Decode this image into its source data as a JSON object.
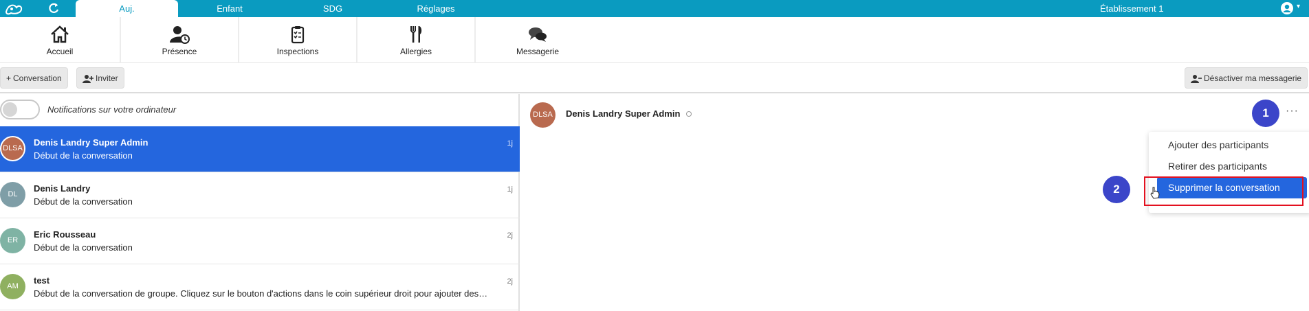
{
  "topbar": {
    "tabs": [
      {
        "label": "Auj.",
        "active": true
      },
      {
        "label": "Enfant",
        "active": false
      },
      {
        "label": "SDG",
        "active": false
      },
      {
        "label": "Réglages",
        "active": false
      }
    ],
    "establishment": "Établissement 1",
    "accent_color": "#0a9bc0"
  },
  "modules": [
    {
      "label": "Accueil",
      "icon": "home-icon"
    },
    {
      "label": "Présence",
      "icon": "user-clock-icon"
    },
    {
      "label": "Inspections",
      "icon": "clipboard-icon"
    },
    {
      "label": "Allergies",
      "icon": "utensils-icon"
    },
    {
      "label": "Messagerie",
      "icon": "chat-bubbles-icon"
    }
  ],
  "toolbar": {
    "conversation_label": "Conversation",
    "invite_label": "Inviter",
    "disable_messaging_label": "Désactiver ma messagerie"
  },
  "notifications": {
    "label": "Notifications sur votre ordinateur",
    "enabled": false
  },
  "conversations": [
    {
      "initials": "DLSA",
      "name": "Denis Landry Super Admin",
      "preview": "Début de la conversation",
      "time": "1j",
      "avatar_color": "#b96a4f",
      "active": true
    },
    {
      "initials": "DL",
      "name": "Denis Landry",
      "preview": "Début de la conversation",
      "time": "1j",
      "avatar_color": "#7f9ea7",
      "active": false
    },
    {
      "initials": "ER",
      "name": "Eric Rousseau",
      "preview": "Début de la conversation",
      "time": "2j",
      "avatar_color": "#7fb3a4",
      "active": false
    },
    {
      "initials": "AM",
      "name": "test",
      "preview": "Début de la conversation de groupe. Cliquez sur le bouton d'actions dans le coin supérieur droit pour ajouter des…",
      "time": "2j",
      "avatar_color": "#8fb060",
      "active": false
    }
  ],
  "chat_header": {
    "initials": "DLSA",
    "name": "Denis Landry Super Admin"
  },
  "actions_menu": {
    "items": [
      "Ajouter des participants",
      "Retirer des participants",
      "Supprimer la conversation"
    ]
  },
  "step_badges": [
    "1",
    "2"
  ],
  "highlight_color": "#e3101f",
  "primary_color": "#2466de"
}
